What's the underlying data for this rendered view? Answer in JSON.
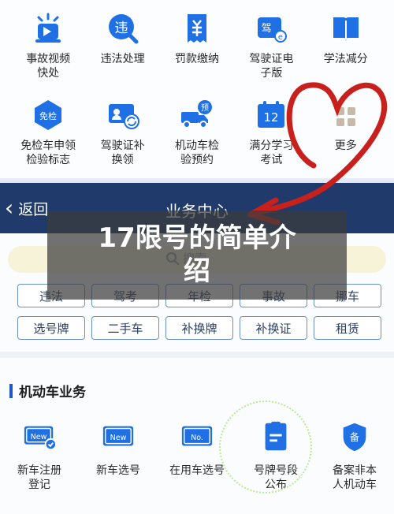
{
  "top_services": [
    {
      "label": "事故视频\n快处",
      "icon": "camera-siren-icon"
    },
    {
      "label": "违法处理",
      "icon": "violation-icon"
    },
    {
      "label": "罚款缴纳",
      "icon": "fine-receipt-icon"
    },
    {
      "label": "驾驶证电\n子版",
      "icon": "e-license-icon"
    },
    {
      "label": "学法减分",
      "icon": "book-icon"
    },
    {
      "label": "免检车申领\n检验标志",
      "icon": "exempt-badge-icon"
    },
    {
      "label": "驾驶证补\n换领",
      "icon": "license-renew-icon"
    },
    {
      "label": "机动车检\n验预约",
      "icon": "truck-booking-icon"
    },
    {
      "label": "满分学习\n考试",
      "icon": "calendar-12-icon"
    },
    {
      "label": "更多",
      "icon": "more-grid-icon"
    }
  ],
  "icon_texts": {
    "violation": "违",
    "exempt": "免检",
    "license": "驾",
    "book_badge": "预",
    "calendar": "12",
    "new": "New",
    "no": "No.",
    "record": "备"
  },
  "nav": {
    "back_label": "返回",
    "title": "业务中心"
  },
  "search": {
    "placeholder": "搜索"
  },
  "chips": [
    "违法",
    "驾考",
    "年检",
    "事故",
    "挪车",
    "选号牌",
    "二手车",
    "补换牌",
    "补换证",
    "租赁"
  ],
  "section": {
    "title": "机动车业务"
  },
  "bottom_services": [
    {
      "label": "新车注册\n登记",
      "icon": "new-plate-check-icon"
    },
    {
      "label": "新车选号",
      "icon": "new-plate-icon"
    },
    {
      "label": "在用车选号",
      "icon": "number-plate-icon"
    },
    {
      "label": "号牌号段\n公布",
      "icon": "plate-list-icon"
    },
    {
      "label": "备案非本\n人机动车",
      "icon": "shield-record-icon"
    }
  ],
  "overlay": {
    "title": "17限号的简单介\n绍"
  },
  "colors": {
    "primary": "#1f6fe5",
    "nav_bg": "#1f3a6b",
    "heart": "#c8201c"
  }
}
